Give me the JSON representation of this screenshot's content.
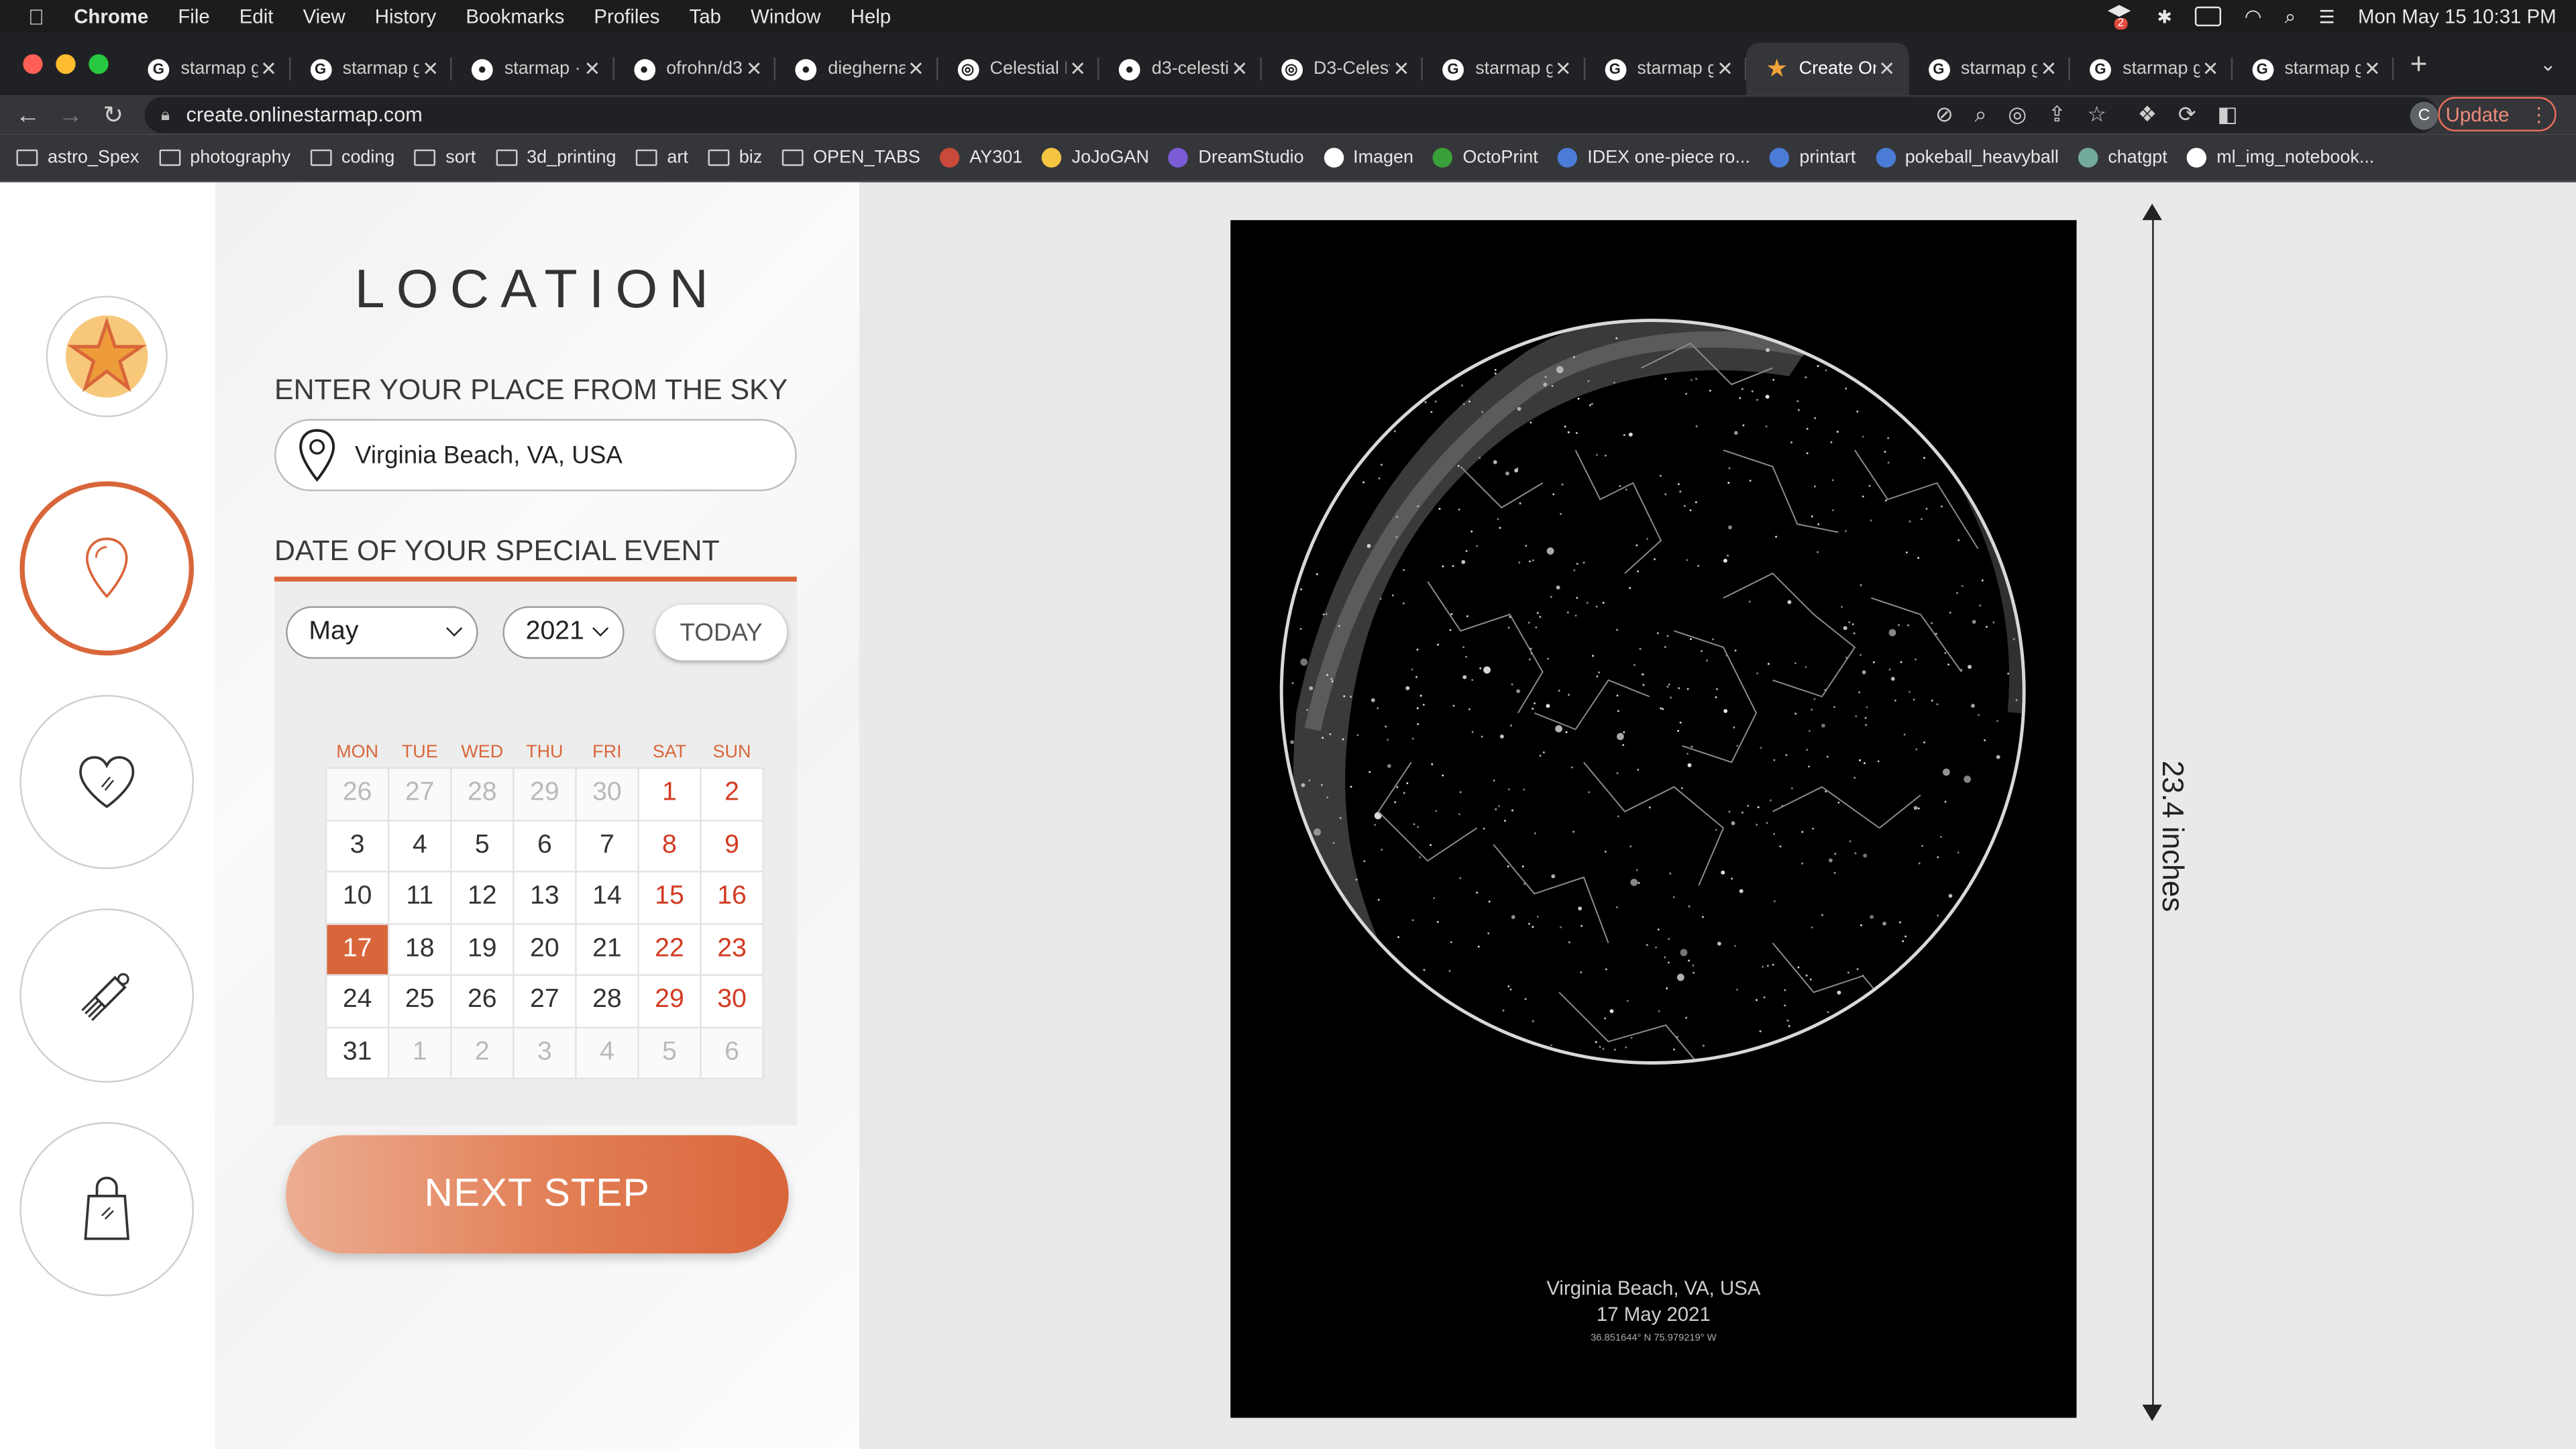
{
  "menubar": {
    "app": "Chrome",
    "items": [
      "File",
      "Edit",
      "View",
      "History",
      "Bookmarks",
      "Profiles",
      "Tab",
      "Window",
      "Help"
    ],
    "dropbox_badge": "2",
    "clock": "Mon May 15  10:31 PM"
  },
  "tabs": [
    {
      "label": "starmap g",
      "icon": "google-icon"
    },
    {
      "label": "starmap g",
      "icon": "google-icon"
    },
    {
      "label": "starmap ·",
      "icon": "github-icon"
    },
    {
      "label": "ofrohn/d3",
      "icon": "github-icon"
    },
    {
      "label": "diegherna",
      "icon": "github-icon"
    },
    {
      "label": "Celestial D",
      "icon": "globe-icon"
    },
    {
      "label": "d3-celesti",
      "icon": "github-icon"
    },
    {
      "label": "D3-Celest",
      "icon": "globe-icon"
    },
    {
      "label": "starmap g",
      "icon": "google-icon"
    },
    {
      "label": "starmap g",
      "icon": "google-icon"
    },
    {
      "label": "Create On",
      "icon": "star-icon",
      "active": true
    },
    {
      "label": "starmap g",
      "icon": "google-icon"
    },
    {
      "label": "starmap g",
      "icon": "google-icon"
    },
    {
      "label": "starmap g",
      "icon": "google-icon"
    }
  ],
  "address": {
    "url": "create.onlinestarmap.com",
    "update_label": "Update",
    "profile_initial": "C"
  },
  "bookmarks": [
    {
      "label": "astro_Spex",
      "type": "folder"
    },
    {
      "label": "photography",
      "type": "folder"
    },
    {
      "label": "coding",
      "type": "folder"
    },
    {
      "label": "sort",
      "type": "folder"
    },
    {
      "label": "3d_printing",
      "type": "folder"
    },
    {
      "label": "art",
      "type": "folder"
    },
    {
      "label": "biz",
      "type": "folder"
    },
    {
      "label": "OPEN_TABS",
      "type": "folder"
    },
    {
      "label": "AY301",
      "type": "site",
      "color": "#c94a3a"
    },
    {
      "label": "JoJoGAN",
      "type": "site",
      "color": "#f5c542"
    },
    {
      "label": "DreamStudio",
      "type": "site",
      "color": "#7b5cd6"
    },
    {
      "label": "Imagen",
      "type": "site",
      "color": "#ffffff"
    },
    {
      "label": "OctoPrint",
      "type": "site",
      "color": "#3aa13a"
    },
    {
      "label": "IDEX one-piece ro...",
      "type": "site",
      "color": "#4a7bd6"
    },
    {
      "label": "printart",
      "type": "site",
      "color": "#4a7bd6"
    },
    {
      "label": "pokeball_heavyball",
      "type": "site",
      "color": "#4a7bd6"
    },
    {
      "label": "chatgpt",
      "type": "site",
      "color": "#74aa9c"
    },
    {
      "label": "ml_img_notebook...",
      "type": "site",
      "color": "#ffffff"
    }
  ],
  "steps": [
    {
      "name": "star-logo"
    },
    {
      "name": "location-step",
      "active": true
    },
    {
      "name": "heart-step"
    },
    {
      "name": "style-step"
    },
    {
      "name": "bag-step"
    }
  ],
  "panel": {
    "title": "LOCATION",
    "place_label": "ENTER YOUR PLACE FROM THE SKY",
    "place_value": "Virginia Beach, VA, USA",
    "date_label": "DATE OF YOUR SPECIAL EVENT",
    "month": "May",
    "year": "2021",
    "today_label": "TODAY",
    "next_label": "NEXT STEP"
  },
  "calendar": {
    "weekdays": [
      "MON",
      "TUE",
      "WED",
      "THU",
      "FRI",
      "SAT",
      "SUN"
    ],
    "weeks": [
      [
        "26",
        "27",
        "28",
        "29",
        "30",
        "1",
        "2"
      ],
      [
        "3",
        "4",
        "5",
        "6",
        "7",
        "8",
        "9"
      ],
      [
        "10",
        "11",
        "12",
        "13",
        "14",
        "15",
        "16"
      ],
      [
        "17",
        "18",
        "19",
        "20",
        "21",
        "22",
        "23"
      ],
      [
        "24",
        "25",
        "26",
        "27",
        "28",
        "29",
        "30"
      ],
      [
        "31",
        "1",
        "2",
        "3",
        "4",
        "5",
        "6"
      ]
    ],
    "muted": [
      [
        0,
        0
      ],
      [
        0,
        1
      ],
      [
        0,
        2
      ],
      [
        0,
        3
      ],
      [
        0,
        4
      ],
      [
        5,
        1
      ],
      [
        5,
        2
      ],
      [
        5,
        3
      ],
      [
        5,
        4
      ],
      [
        5,
        5
      ],
      [
        5,
        6
      ]
    ],
    "selected": [
      3,
      0
    ]
  },
  "poster": {
    "place": "Virginia Beach, VA, USA",
    "date": "17 May 2021",
    "coords": "36.851644° N 75.979219° W"
  },
  "dimension": "23.4 inches",
  "colors": {
    "accent": "#d9663a",
    "weekend": "#d23a21"
  }
}
